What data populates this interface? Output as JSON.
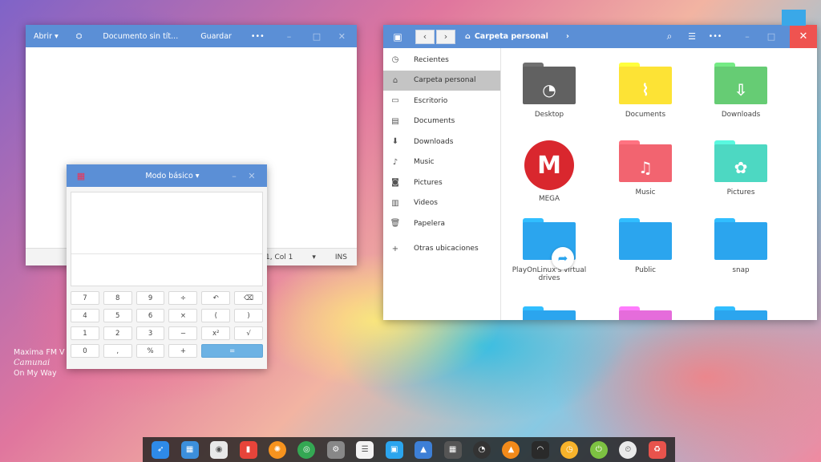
{
  "editor": {
    "open_label": "Abrir",
    "doc_title": "Documento sin tít...",
    "save_label": "Guardar",
    "menu_glyph": "•••",
    "cursor_pos": "1, Col 1",
    "ins": "INS"
  },
  "calculator": {
    "mode": "Modo básico",
    "keys": [
      "7",
      "8",
      "9",
      "÷",
      "↶",
      "⌫",
      "4",
      "5",
      "6",
      "×",
      "(",
      ")",
      "1",
      "2",
      "3",
      "−",
      "x²",
      "√",
      "0",
      ",",
      "%",
      "+",
      "="
    ]
  },
  "filemanager": {
    "location": "Carpeta personal",
    "sidebar": [
      {
        "label": "Recientes",
        "icon": "clock-icon"
      },
      {
        "label": "Carpeta personal",
        "icon": "home-icon",
        "selected": true
      },
      {
        "label": "Escritorio",
        "icon": "desktop-icon"
      },
      {
        "label": "Documents",
        "icon": "documents-icon"
      },
      {
        "label": "Downloads",
        "icon": "download-icon"
      },
      {
        "label": "Music",
        "icon": "music-icon"
      },
      {
        "label": "Pictures",
        "icon": "camera-icon"
      },
      {
        "label": "Videos",
        "icon": "film-icon"
      },
      {
        "label": "Papelera",
        "icon": "trash-icon"
      },
      {
        "label": "Otras ubicaciones",
        "icon": "plus-icon"
      }
    ],
    "items": [
      {
        "label": "Desktop",
        "color": "#616161",
        "glyph": "◔"
      },
      {
        "label": "Documents",
        "color": "#fde335",
        "glyph": "⌇"
      },
      {
        "label": "Downloads",
        "color": "#66cc74",
        "glyph": "⇩"
      },
      {
        "label": "MEGA",
        "color": "#d9272e",
        "glyph": "M"
      },
      {
        "label": "Music",
        "color": "#f26470",
        "glyph": "♫"
      },
      {
        "label": "Pictures",
        "color": "#4dd8c2",
        "glyph": "✿"
      },
      {
        "label": "PlayOnLinux's virtual drives",
        "color": "#2ba5ee",
        "glyph": "➦"
      },
      {
        "label": "Public",
        "color": "#2ba5ee",
        "glyph": ""
      },
      {
        "label": "snap",
        "color": "#2ba5ee",
        "glyph": ""
      },
      {
        "label": "",
        "color": "#2ba5ee",
        "glyph": ""
      },
      {
        "label": "",
        "color": "#e56cdb",
        "glyph": ""
      },
      {
        "label": "",
        "color": "#2ba5ee",
        "glyph": ""
      }
    ]
  },
  "desktop_text": {
    "line1": "Maxima FM V",
    "line2": "Camunai",
    "line3": "On My Way"
  },
  "dock": [
    {
      "name": "launcher",
      "color": "#2e8ae8"
    },
    {
      "name": "workspaces",
      "color": "#3c8fdc"
    },
    {
      "name": "settings",
      "color": "#e8e8e8"
    },
    {
      "name": "sticky",
      "color": "#e7443a"
    },
    {
      "name": "orange",
      "color": "#f7931e"
    },
    {
      "name": "chrome",
      "color": "#34a853"
    },
    {
      "name": "prefs",
      "color": "#888888"
    },
    {
      "name": "notes",
      "color": "#f3f3f3"
    },
    {
      "name": "files",
      "color": "#2ba5ee"
    },
    {
      "name": "appcenter",
      "color": "#3d7fd6"
    },
    {
      "name": "calculator",
      "color": "#555555"
    },
    {
      "name": "timer",
      "color": "#333333"
    },
    {
      "name": "vlc",
      "color": "#f28a1a"
    },
    {
      "name": "wifi",
      "color": "#2a2a2a"
    },
    {
      "name": "clock",
      "color": "#f7b32b"
    },
    {
      "name": "power",
      "color": "#7dc242"
    },
    {
      "name": "time",
      "color": "#eaeaea"
    },
    {
      "name": "trash",
      "color": "#e8534c"
    }
  ]
}
